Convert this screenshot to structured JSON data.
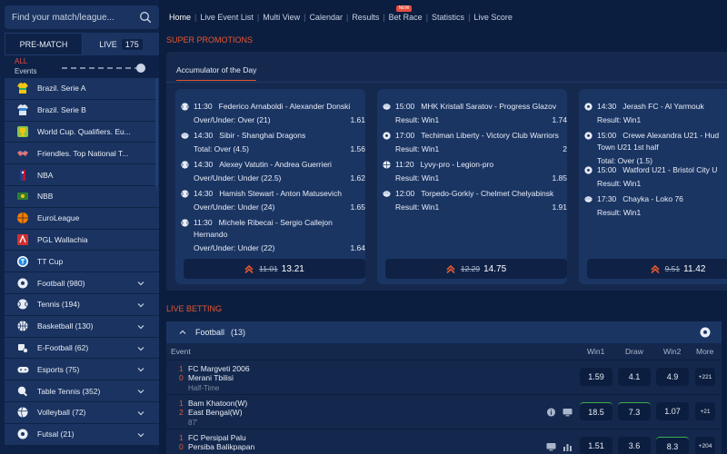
{
  "search": {
    "placeholder": "Find your match/league..."
  },
  "mode_tabs": {
    "pre_match": "PRE-MATCH",
    "live": "LIVE",
    "live_count": "175"
  },
  "filter": {
    "all": "ALL",
    "events": "Events"
  },
  "sidebar": {
    "items": [
      {
        "label": "Brazil. Serie A",
        "icon": "brazil-jersey-icon"
      },
      {
        "label": "Brazil. Serie B",
        "icon": "jersey-icon"
      },
      {
        "label": "World Cup. Qualifiers. Eu...",
        "icon": "trophy-icon"
      },
      {
        "label": "Friendles. Top National T...",
        "icon": "handshake-icon"
      },
      {
        "label": "NBA",
        "icon": "nba-logo-icon"
      },
      {
        "label": "NBB",
        "icon": "nbb-logo-icon"
      },
      {
        "label": "EuroLeague",
        "icon": "euroleague-ball-icon"
      },
      {
        "label": "PGL Wallachia",
        "icon": "pgl-logo-icon"
      },
      {
        "label": "TT Cup",
        "icon": "tt-cup-logo-icon"
      }
    ],
    "sports": [
      {
        "label": "Football (980)",
        "icon": "football-icon"
      },
      {
        "label": "Tennis (194)",
        "icon": "tennis-icon"
      },
      {
        "label": "Basketball (130)",
        "icon": "basketball-icon"
      },
      {
        "label": "E-Football (62)",
        "icon": "e-football-icon"
      },
      {
        "label": "Esports (75)",
        "icon": "gamepad-icon"
      },
      {
        "label": "Table Tennis (352)",
        "icon": "table-tennis-icon"
      },
      {
        "label": "Volleyball (72)",
        "icon": "volleyball-icon"
      },
      {
        "label": "Futsal (21)",
        "icon": "futsal-icon"
      }
    ]
  },
  "nav": {
    "links": [
      "Home",
      "Live Event List",
      "Multi View",
      "Calendar",
      "Results",
      "Bet Race",
      "Statistics",
      "Live Score"
    ],
    "new_badge": "NEW"
  },
  "promotions": {
    "title": "SUPER PROMOTIONS",
    "tab": "Accumulator of the Day",
    "cards": [
      {
        "selections": [
          {
            "time": "11:30",
            "match": "Federico Arnaboldi - Alexander Donski",
            "market": "Over/Under: Over (21)",
            "odd": "1.61"
          },
          {
            "time": "14:30",
            "match": "Sibir - Shanghai Dragons",
            "market": "Total: Over (4.5)",
            "odd": "1.56"
          },
          {
            "time": "14:30",
            "match": "Alexey Vatutin - Andrea Guerrieri",
            "market": "Over/Under: Under (22.5)",
            "odd": "1.62"
          },
          {
            "time": "14:30",
            "match": "Hamish Stewart - Anton Matusevich",
            "market": "Over/Under: Under (24)",
            "odd": "1.65"
          },
          {
            "time": "11:30",
            "match": "Michele Ribecai - Sergio Callejon",
            "match2": "Hernando",
            "market": "Over/Under: Under (22)",
            "odd": "1.64"
          }
        ],
        "old_total": "11.01",
        "total": "13.21"
      },
      {
        "selections": [
          {
            "time": "15:00",
            "match": "MHK Kristall Saratov - Progress Glazov",
            "market": "Result: Win1",
            "odd": "1.74"
          },
          {
            "time": "17:00",
            "match": "Techiman Liberty - Victory Club Warriors",
            "market": "Result: Win1",
            "odd": "2"
          },
          {
            "time": "11:20",
            "match": "Lyvy-pro - Legion-pro",
            "market": "Result: Win1",
            "odd": "1.85"
          },
          {
            "time": "12:00",
            "match": "Torpedo-Gorkiy - Chelmet Chelyabinsk",
            "market": "Result: Win1",
            "odd": "1.91"
          }
        ],
        "old_total": "12.29",
        "total": "14.75"
      },
      {
        "selections": [
          {
            "time": "14:30",
            "match": "Jerash FC - Al Yarmouk",
            "market": "Result: Win1",
            "odd": ""
          },
          {
            "time": "15:00",
            "match": "Crewe Alexandra U21 - Hud",
            "match2": "Town U21 1st half",
            "market": "Total: Over (1.5)",
            "odd": ""
          },
          {
            "time": "15:00",
            "match": "Watford U21 - Bristol City U",
            "market": "Result: Win1",
            "odd": ""
          },
          {
            "time": "17:30",
            "match": "Chayka - Loko 76",
            "market": "Result: Win1",
            "odd": ""
          }
        ],
        "old_total": "9.51",
        "total": "11.42"
      }
    ]
  },
  "live": {
    "title": "LIVE BETTING",
    "sport": "Football",
    "sport_count": "(13)",
    "columns": {
      "event": "Event",
      "win1": "Win1",
      "draw": "Draw",
      "win2": "Win2",
      "more": "More"
    },
    "matches": [
      {
        "home": "FC Margveti 2006",
        "away": "Merani Tbilisi",
        "home_score": "1",
        "away_score": "0",
        "status": "Half-Time",
        "win1": "1.59",
        "draw": "4.1",
        "win2": "4.9",
        "more": "+221"
      },
      {
        "home": "Bam Khatoon(W)",
        "away": "East Bengal(W)",
        "home_score": "1",
        "away_score": "2",
        "status": "87'",
        "win1": "18.5",
        "draw": "7.3",
        "win2": "1.07",
        "more": "+21"
      },
      {
        "home": "FC Persipal Palu",
        "away": "Persiba Balikpapan",
        "home_score": "1",
        "away_score": "0",
        "status": "",
        "win1": "1.51",
        "draw": "3.6",
        "win2": "8.3",
        "more": "+204"
      }
    ]
  },
  "colors": {
    "accent": "#e8572f",
    "background": "#0c1e3f",
    "panel": "#15294f",
    "card": "#1b3563",
    "highlight": "#3fae4e"
  }
}
